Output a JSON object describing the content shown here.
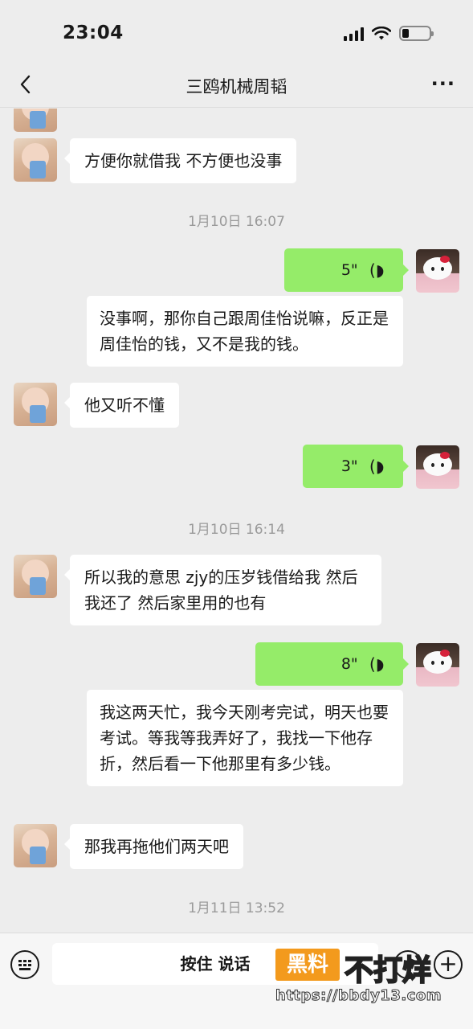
{
  "status_bar": {
    "time": "23:04"
  },
  "nav": {
    "title": "三鸥机械周韬",
    "more": "···"
  },
  "messages": {
    "m1": {
      "text": "方便你就借我 不方便也没事"
    },
    "ts1": "1月10日 16:07",
    "v1": {
      "duration": "5\"",
      "transcript": "没事啊，那你自己跟周佳怡说嘛，反正是周佳怡的钱，又不是我的钱。"
    },
    "m2": {
      "text": "他又听不懂"
    },
    "v2": {
      "duration": "3\""
    },
    "ts2": "1月10日 16:14",
    "m3": {
      "text": "所以我的意思 zjy的压岁钱借给我 然后我还了 然后家里用的也有"
    },
    "v3": {
      "duration": "8\"",
      "transcript": "我这两天忙，我今天刚考完试，明天也要考试。等我等我弄好了，我找一下他存折，然后看一下他那里有多少钱。"
    },
    "m4": {
      "text": "那我再拖他们两天吧"
    },
    "ts3": "1月11日 13:52"
  },
  "input_bar": {
    "talk_label": "按住 说话"
  },
  "watermark": {
    "badge": "黑料",
    "text": "不打烊",
    "url": "https://bbdy13.com"
  },
  "colors": {
    "background": "#ededed",
    "my_bubble": "#95ec69",
    "their_bubble": "#ffffff",
    "watermark_orange": "#f39a1d"
  }
}
